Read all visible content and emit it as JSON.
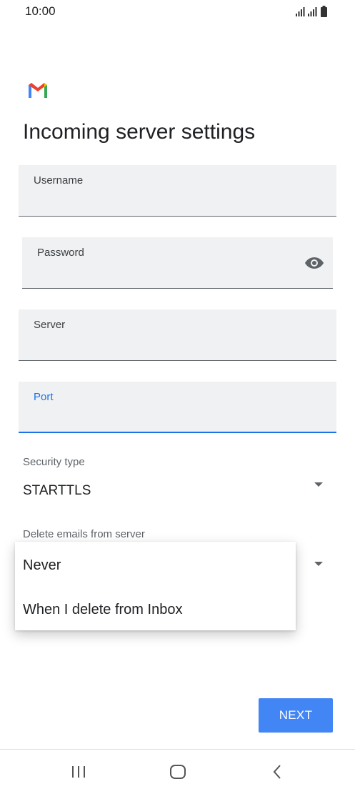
{
  "status_bar": {
    "time": "10:00",
    "icons": [
      "signal-icon",
      "signal-icon",
      "battery-icon"
    ]
  },
  "logo": "gmail-logo",
  "page": {
    "title": "Incoming server settings"
  },
  "fields": {
    "username": {
      "label": "Username",
      "value": ""
    },
    "password": {
      "label": "Password",
      "value": "",
      "toggle_icon": "eye-icon"
    },
    "server": {
      "label": "Server",
      "value": ""
    },
    "port": {
      "label": "Port",
      "value": "",
      "focused": true
    }
  },
  "security": {
    "label": "Security type",
    "value": "STARTTLS"
  },
  "delete_emails": {
    "label": "Delete emails from server",
    "options": [
      "Never",
      "When I delete from Inbox"
    ]
  },
  "actions": {
    "next_label": "NEXT"
  },
  "nav_bar": {
    "icons": [
      "recents-icon",
      "home-icon",
      "back-icon"
    ]
  },
  "colors": {
    "accent": "#1a73e8",
    "button": "#4285f4",
    "field_bg": "#f0f1f3"
  }
}
